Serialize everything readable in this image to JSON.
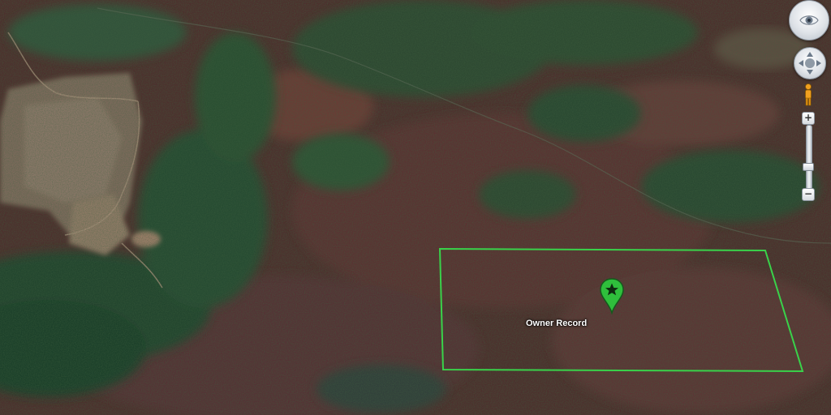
{
  "map": {
    "type": "satellite",
    "parcel_label": "Owner Record",
    "parcel_outline_color": "#39d24a",
    "marker_color": "#2fbf3c",
    "marker_icon": "star-icon"
  },
  "controls": {
    "look_icon": "eye-icon",
    "navigate_icon": "pan-icon",
    "street_view_icon": "pegman-icon",
    "zoom_in_label": "+",
    "zoom_out_label": "−",
    "zoom_level_fraction": 0.65
  }
}
